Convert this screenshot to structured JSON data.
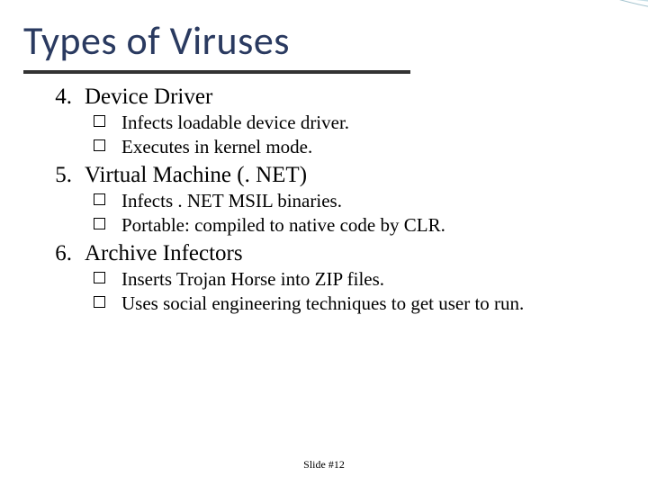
{
  "title": "Types of Viruses",
  "items": [
    {
      "num": "4.",
      "label": "Device Driver",
      "subs": [
        "Infects loadable device driver.",
        "Executes in kernel mode."
      ]
    },
    {
      "num": "5.",
      "label": "Virtual Machine (. NET)",
      "subs": [
        "Infects . NET MSIL binaries.",
        "Portable: compiled to native code by CLR."
      ]
    },
    {
      "num": "6.",
      "label": "Archive Infectors",
      "subs": [
        "Inserts Trojan Horse into ZIP files.",
        "Uses social engineering techniques to get user to run."
      ]
    }
  ],
  "footer": "Slide #12"
}
